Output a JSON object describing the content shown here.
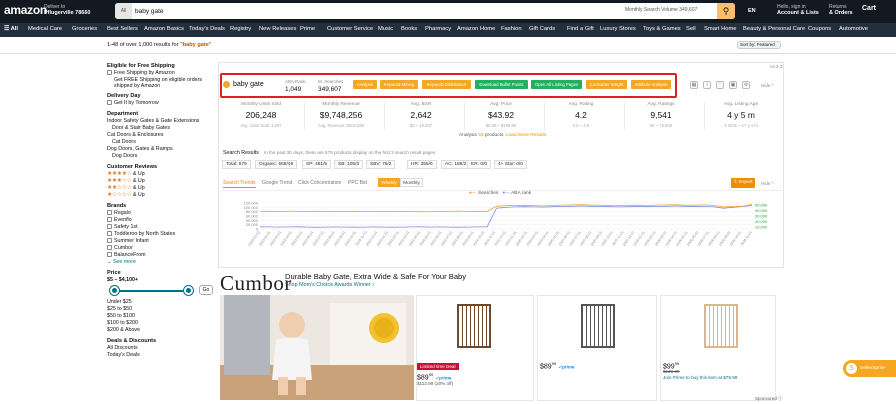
{
  "header": {
    "logo": "amazon",
    "deliver_to": "Deliver to",
    "location": "Pflugerville 78660",
    "search_category": "All",
    "search_query": "baby gate",
    "monthly_search_volume": "Monthly Search Volume 349,607",
    "language": "EN",
    "account_line1": "Hello, sign in",
    "account_line2": "Account & Lists",
    "returns_line1": "Returns",
    "returns_line2": "& Orders",
    "cart": "Cart"
  },
  "subnav": {
    "all": "All",
    "items": [
      "Medical Care",
      "Groceries",
      "Best Sellers",
      "Amazon Basics",
      "Today's Deals",
      "Registry",
      "New Releases",
      "Prime",
      "Customer Service",
      "Music",
      "Books",
      "Pharmacy",
      "Amazon Home",
      "Fashion",
      "Gift Cards",
      "Find a Gift",
      "Luxury Stores",
      "Toys & Games",
      "Sell",
      "Smart Home",
      "Beauty & Personal Care",
      "Coupons",
      "Automotive"
    ]
  },
  "results": {
    "text": "1-48 of over 1,000 results for ",
    "query": "\"baby gate\"",
    "sort": "Sort by: Featured"
  },
  "sidebar": {
    "free_shipping_title": "Eligible for Free Shipping",
    "free_shipping_items": [
      "Free Shipping by Amazon",
      "Get FREE Shipping on eligible orders shipped by Amazon"
    ],
    "delivery_title": "Delivery Day",
    "delivery_items": [
      "Get It by Tomorrow"
    ],
    "department_title": "Department",
    "department_items": [
      "Indoor Safety Gates & Gate Extensions",
      "Door & Stair Baby Gates",
      "Cat Doors & Enclosures",
      "Cat Doors",
      "Dog Doors, Gates & Ramps",
      "Dog Doors"
    ],
    "reviews_title": "Customer Reviews",
    "reviews_items": [
      "& Up",
      "& Up",
      "& Up",
      "& Up"
    ],
    "brands_title": "Brands",
    "brands_items": [
      "Regalo",
      "Evenflo",
      "Safety 1st",
      "Toddleroo by North States",
      "Summer Infant",
      "Cumbor",
      "BalanceFrom"
    ],
    "see_more": "See more",
    "price_title": "Price",
    "price_range": "$5 – $4,100+",
    "go": "Go",
    "price_items": [
      "Under $25",
      "$25 to $50",
      "$50 to $100",
      "$100 to $200",
      "$200 & Above"
    ],
    "deals_title": "Deals & Discounts",
    "deals_items": [
      "All Discounts",
      "Today's Deals"
    ]
  },
  "extension": {
    "version": "v4.3.3",
    "keyword": "baby gate",
    "aba_rank_label": "ABA Rank",
    "aba_rank": "1,049",
    "searches_label": "M. Searches",
    "searches": "349,607",
    "buttons": [
      "Analysis",
      "Keyword Mining",
      "Keyword Distribution",
      "Download Bullet Points",
      "Open All Listing Pages",
      "Consumer Insight",
      "Attribute Analysis"
    ],
    "hide": "Hide",
    "metrics": [
      {
        "label": "Monthly Units Sold",
        "value": "206,248",
        "sub": "Avg. Units Sold: 4,297"
      },
      {
        "label": "Monthly Revenue",
        "value": "$9,748,256",
        "sub": "Avg. Revenue: $203,088"
      },
      {
        "label": "Avg. BSR",
        "value": "2,642",
        "sub": "$3 ~ 16,837"
      },
      {
        "label": "Avg. Price",
        "value": "$43.92",
        "sub": "$8.69 ~ $199.90"
      },
      {
        "label": "Avg. Rating",
        "value": "4.2",
        "sub": "3.8 ~ 4.8"
      },
      {
        "label": "Avg. Ratings",
        "value": "9,541",
        "sub": "56 ~ 76,809"
      },
      {
        "label": "Avg. Listing Age",
        "value": "4 y 5 m",
        "sub": "3 mths ~ 17 y 4 m"
      }
    ],
    "analysis_prefix": "Analysis ",
    "analysis_count": "53",
    "analysis_mid": " products, ",
    "analysis_link": "Load More Results",
    "sr_title": "Search Results",
    "sr_desc": "In the past 30 days, there are 579 products display on the first 3 search result pages",
    "chips": [
      "Total: 579",
      "Organic: 568/49",
      "SP: 481/5",
      "SB: 105/3",
      "SBV: 75/2",
      "HR: 355/0",
      "AC: 188/2",
      "ER: 0/0",
      "4+ Star: 0/0"
    ],
    "tabs": [
      "Search Trends",
      "Google Trend",
      "Click Concentration",
      "PPC Bid"
    ],
    "segs": [
      "Weekly",
      "Monthly"
    ],
    "export": "Export",
    "legend": [
      "Searches",
      "ABA rank"
    ]
  },
  "chart_data": {
    "type": "line",
    "series": [
      {
        "name": "Searches",
        "color": "#f0a030",
        "values": [
          270000,
          272000,
          268000,
          275000,
          270000,
          268000,
          272000,
          270000,
          266000,
          269000,
          272000,
          271000,
          268000,
          270000,
          269000,
          271000,
          268000,
          265000,
          268000,
          270000,
          271000,
          275000,
          268000,
          272000,
          270000,
          350000,
          360000,
          362000,
          365000,
          360000,
          355000,
          362000,
          368000,
          370000,
          372000,
          368000,
          365000,
          362000,
          360000,
          365000,
          364000,
          362000,
          368000,
          370000,
          372000,
          365000,
          368000,
          370000,
          360000,
          340000,
          345000,
          350000,
          380000
        ]
      },
      {
        "name": "ABA rank",
        "color": "#7b8fe0",
        "values": [
          1450,
          1452,
          1455,
          1452,
          1450,
          1455,
          1458,
          1455,
          1452,
          1455,
          1458,
          1455,
          1452,
          1455,
          1458,
          1455,
          1452,
          1450,
          1455,
          1452,
          1455,
          1458,
          1455,
          1452,
          1450,
          1020,
          1000,
          990,
          985,
          990,
          995,
          985,
          980,
          975,
          970,
          975,
          980,
          985,
          990,
          985,
          980,
          985,
          980,
          975,
          970,
          980,
          975,
          980,
          990,
          1020,
          1000,
          980,
          960
        ]
      }
    ],
    "yticks_left": [
      "120,000",
      "100,000",
      "80,000",
      "60,000",
      "40,000",
      "20,000",
      "0"
    ],
    "yticks_right": [
      "50,000",
      "40,000",
      "30,000",
      "20,000",
      "10,000"
    ],
    "xlabels": [
      "2023-01-01",
      "2023-02-01",
      "2023-03-01",
      "2023-04-01",
      "2023-05-01",
      "2023-06-01",
      "2023-07-01",
      "2023-08-01",
      "2023-09-01",
      "2023-10-01",
      "2023-11-01",
      "2023-12-01",
      "2024-01-01",
      "2024-02-01",
      "2024-03-01",
      "2024-04-01",
      "2024-05-01",
      "2024-06-01",
      "2024-07-01",
      "2024-08-01",
      "2024-09-01",
      "2024-10-01",
      "2024-11-01",
      "2024-12-01",
      "2025-01-01",
      "2025-02-01",
      "2025-03-01",
      "2025-04-01",
      "2025-05-01",
      "2025-06-01",
      "2025-07-01",
      "2025-08-01",
      "2025-09-01",
      "2025-10-01",
      "2025-11-01",
      "2025-12-01",
      "2026-01-01",
      "2026-02-01",
      "2026-03-01",
      "2026-04-01",
      "2026-05-01",
      "2026-06-01",
      "2026-07-01",
      "2026-08-01",
      "2026-09-01",
      "2026-10-01",
      "2026-11-01"
    ]
  },
  "ad": {
    "brand": "Cumbor",
    "title": "Durable Baby Gate, Extra Wide & Safe For Your Baby",
    "link": "Shop Mom's Choice Awards Winner",
    "deal_badge": "Limited time Deal",
    "p1_price": "$89",
    "p1_cents": "99",
    "p1_prime": "✓prime",
    "p1_list": "$112.99 (20% off)",
    "p2_price": "$89",
    "p2_cents": "99",
    "p2_prime": "✓prime",
    "p3_price": "$99",
    "p3_cents": "99",
    "p3_list": "$129.99",
    "p3_prime_line": "Join Prime to buy this item at $79.99",
    "sponsored": "Sponsored ⓘ"
  },
  "sellersprite": "SellerSprite"
}
